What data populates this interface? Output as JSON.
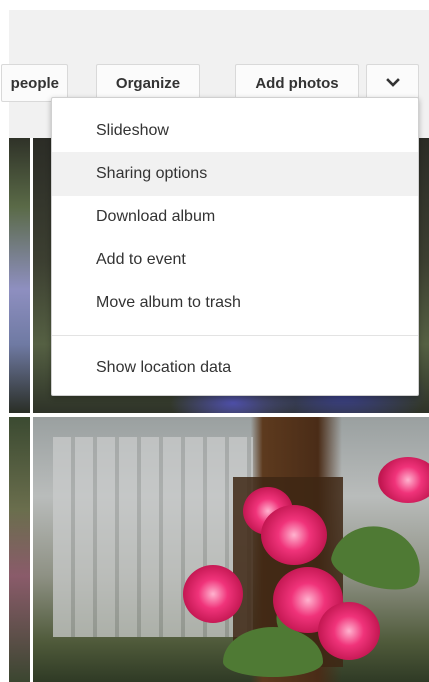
{
  "toolbar": {
    "people_label": "people",
    "organize_label": "Organize",
    "add_photos_label": "Add photos",
    "more_icon": "chevron-down-icon"
  },
  "menu": {
    "items": [
      {
        "label": "Slideshow"
      },
      {
        "label": "Sharing options",
        "highlighted": true
      },
      {
        "label": "Download album"
      },
      {
        "label": "Add to event"
      },
      {
        "label": "Move album to trash"
      },
      {
        "label": "Show location data"
      }
    ]
  },
  "colors": {
    "toolbar_bg": "#f1f1f1",
    "button_bg": "#fbfbfb",
    "menu_hover_bg": "#f1f1f1",
    "text": "#333333"
  }
}
